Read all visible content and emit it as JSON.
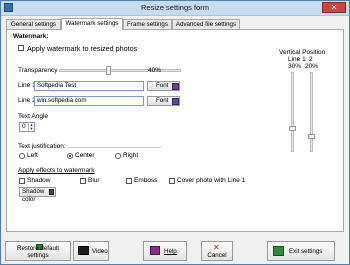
{
  "window": {
    "title": "Resize settings form"
  },
  "tabs": [
    {
      "label": "General settings"
    },
    {
      "label": "Watermark settings"
    },
    {
      "label": "Frame settings"
    },
    {
      "label": "Advanced file settings"
    }
  ],
  "watermark": {
    "section_label": "Watermark:",
    "apply_checkbox_label": "Apply watermark to resized photos",
    "transparency_label": "Transparency",
    "transparency_value": "40%",
    "transparency_fraction": 0.4,
    "line1_label": "Line 1",
    "line1_value": "Softpedia Test",
    "line2_label": "Line 2",
    "line2_value": "win.softpedia.com",
    "font_button": "Font",
    "text_angle_label": "Text Angle",
    "text_angle_value": "0",
    "justification_label": "Text justification:",
    "justification_options": [
      "Left",
      "Center",
      "Right"
    ],
    "justification_selected": "Center",
    "effects_label": "Apply effects to watermark",
    "effects": [
      "Shadow",
      "Blur",
      "Emboss",
      "Cover photo with Line 1"
    ],
    "shadow_color_button": "Shadow color"
  },
  "vertical_position": {
    "title": "Vertical Position",
    "line1_label": "Line 1",
    "line2_label": "2",
    "line1_value": "30%",
    "line2_value": "20%"
  },
  "footer": {
    "restore_button": "Restore default settings",
    "video_button": "Video",
    "help_button": "Help",
    "cancel_button": "Cancel",
    "exit_button": "Exit settings"
  }
}
